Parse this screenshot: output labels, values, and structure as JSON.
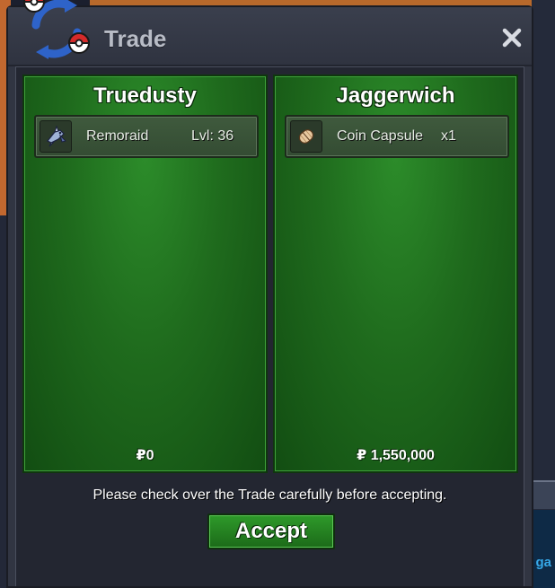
{
  "window": {
    "title": "Trade"
  },
  "left_player": {
    "name": "Truedusty",
    "item": {
      "icon": "remoraid-sprite-icon",
      "name": "Remoraid",
      "detail": "Lvl: 36"
    },
    "money": "₽0"
  },
  "right_player": {
    "name": "Jaggerwich",
    "item": {
      "icon": "coin-capsule-icon",
      "name": "Coin Capsule",
      "detail": "x1"
    },
    "money": "₽ 1,550,000"
  },
  "notice": "Please check over the Trade carefully before accepting.",
  "accept_label": "Accept",
  "background_fragment_text": "ga",
  "colors": {
    "panel_green": "#1f6b1d",
    "accept_green": "#2e9a2a",
    "window_bg": "#313542"
  }
}
